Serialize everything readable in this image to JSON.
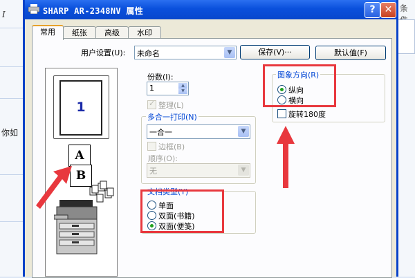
{
  "background": {
    "left_char": "I",
    "side_text": "你如",
    "right_label": "条件"
  },
  "dialog": {
    "title": "SHARP AR-2348NV 属性",
    "help_glyph": "?",
    "close_glyph": "✕",
    "tabs": [
      "常用",
      "纸张",
      "高级",
      "水印"
    ],
    "active_tab": "常用"
  },
  "settings": {
    "user_settings_label": "用户设置(U):",
    "user_settings_value": "未命名",
    "save_button": "保存(V)···",
    "default_button": "默认值(F)"
  },
  "preview": {
    "page_number": "1",
    "card_front": "A",
    "card_back": "B"
  },
  "copies": {
    "label": "份数(I):",
    "value": "1"
  },
  "collate": {
    "label": "整理(L)",
    "checked": true,
    "enabled": false
  },
  "nup": {
    "title": "多合一打印(N)",
    "value": "一合一",
    "border_label": "边框(B)",
    "order_label": "顺序(O):",
    "order_value": "无"
  },
  "orientation": {
    "title": "图象方向(R)",
    "options": [
      "纵向",
      "横向"
    ],
    "selected": "纵向",
    "rotate_label": "旋转180度",
    "rotate_checked": false
  },
  "document_style": {
    "title": "文档类型(Y)",
    "options": [
      "单面",
      "双面(书籍)",
      "双面(便笺)"
    ],
    "selected": "双面(便笺)"
  },
  "annotations": {
    "highlight_color": "#e8383e",
    "title_bar_color": "#0a50dc",
    "tab_accent_color": "#e6a12b"
  }
}
